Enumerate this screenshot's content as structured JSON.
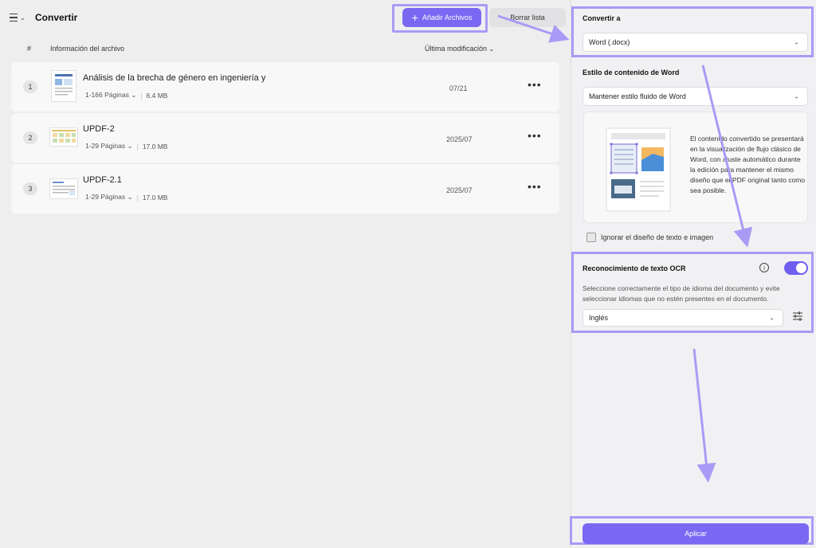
{
  "header": {
    "title": "Convertir",
    "add_files": "Añadir Archivos",
    "clear_list": "Borrar lista"
  },
  "table": {
    "col_num": "#",
    "col_info": "Información del archivo",
    "col_modified": "Última modificación"
  },
  "files": [
    {
      "index": "1",
      "name": "Análisis de la brecha de género en ingeniería y",
      "pages": "1-166 Páginas",
      "size": "6.4 MB",
      "date": "07/21"
    },
    {
      "index": "2",
      "name": "UPDF-2",
      "pages": "1-29 Páginas",
      "size": "17.0 MB",
      "date": "2025/07"
    },
    {
      "index": "3",
      "name": "UPDF-2.1",
      "pages": "1-29 Páginas",
      "size": "17.0 MB",
      "date": "2025/07"
    }
  ],
  "panel": {
    "convert_to_label": "Convertir a",
    "convert_to_value": "Word (.docx)",
    "word_style_label": "Estilo de contenido de Word",
    "word_style_value": "Mantener estilo fluido de Word",
    "preview_description": "El contenido convertido se presentará en la visualización de flujo clásico de Word, con ajuste automático durante la edición para mantener el mismo diseño que el PDF original tanto como sea posible.",
    "ignore_layout": "Ignorar el diseño de texto e imagen",
    "ocr_label": "Reconocimiento de texto OCR",
    "ocr_enabled": true,
    "ocr_description": "Seleccione correctamente el tipo de idioma del documento y evite seleccionar idiomas que no estén presentes en el documento.",
    "language": "Inglés",
    "apply": "Aplicar"
  },
  "colors": {
    "accent": "#7b68f2",
    "highlight": "#a99bf5"
  }
}
